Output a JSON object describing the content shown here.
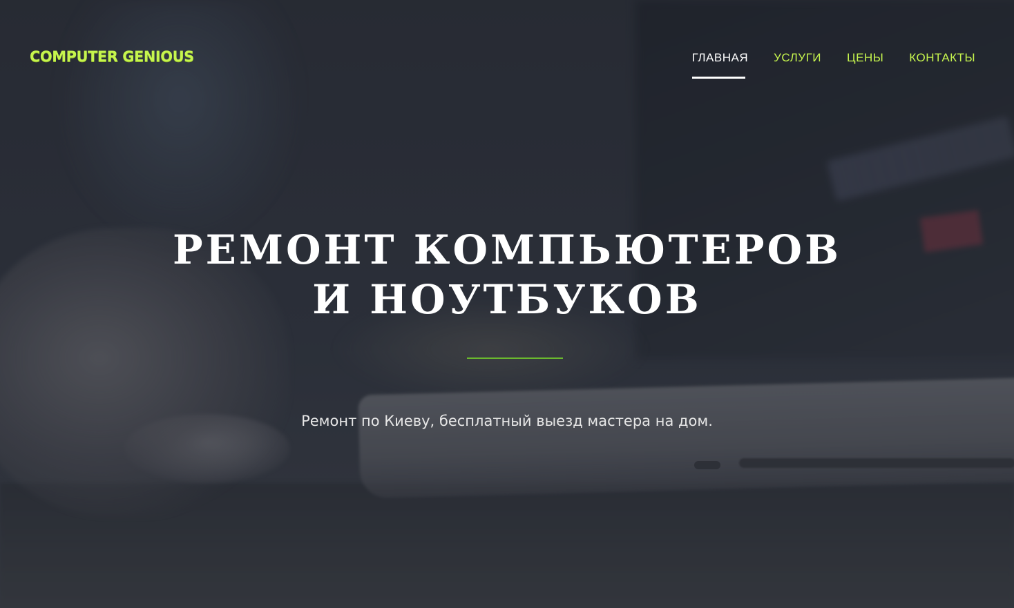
{
  "header": {
    "logo": "COMPUTER GENIOUS",
    "nav": [
      {
        "label": "ГЛАВНАЯ",
        "active": true
      },
      {
        "label": "УСЛУГИ",
        "active": false
      },
      {
        "label": "ЦЕНЫ",
        "active": false
      },
      {
        "label": "КОНТАКТЫ",
        "active": false
      }
    ]
  },
  "hero": {
    "title_line1": "РЕМОНТ КОМПЬЮТЕРОВ",
    "title_line2": "И НОУТБУКОВ",
    "subtitle": "Ремонт по Киеву, бесплатный выезд мастера на дом."
  },
  "colors": {
    "accent": "#c6f54e",
    "divider": "#6ab82e",
    "active_nav": "#ffffff"
  }
}
